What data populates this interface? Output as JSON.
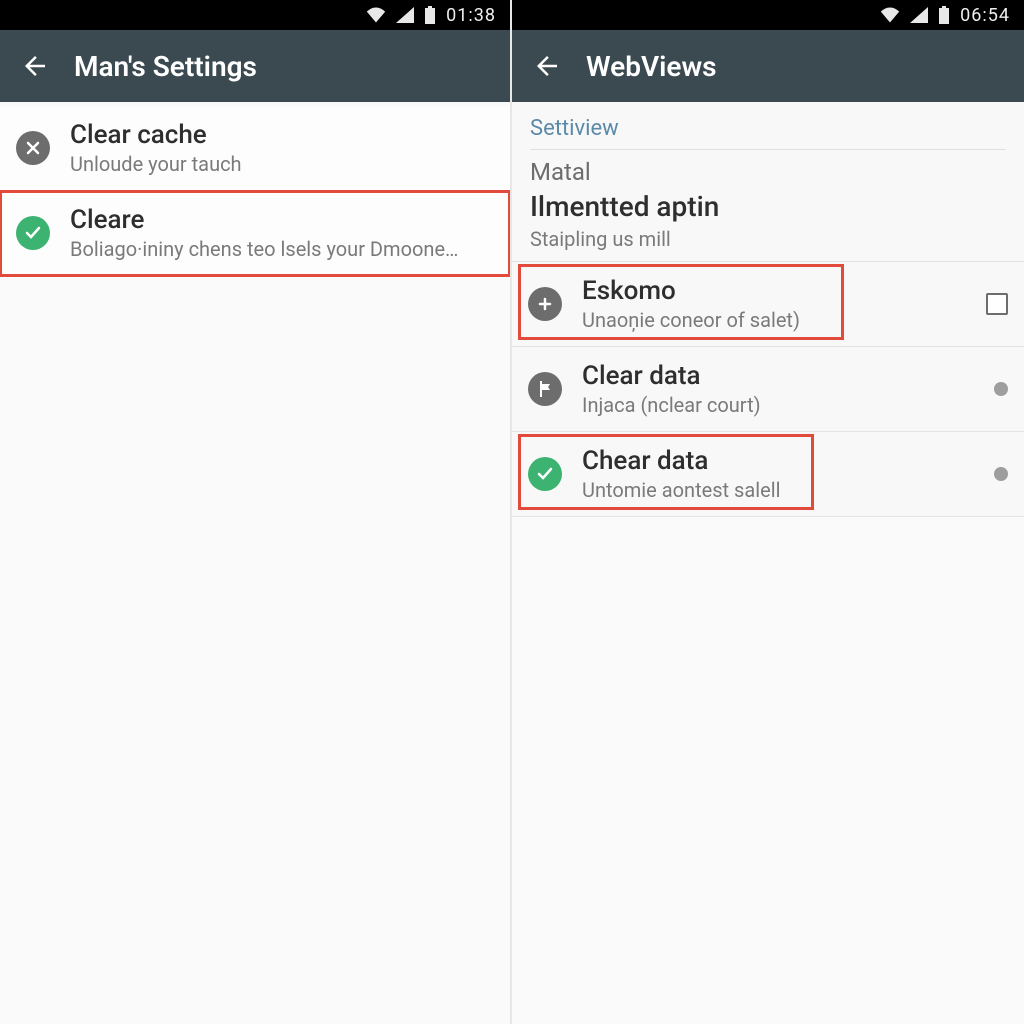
{
  "left": {
    "status": {
      "time": "01:38"
    },
    "appbar": {
      "title": "Man's Settings"
    },
    "rows": [
      {
        "icon": "x",
        "title": "Clear cache",
        "sub": "Unloude your tauch"
      },
      {
        "icon": "check",
        "title": "Cleare",
        "sub": "Boliago·ininy chens teo lsels your Dmoone…"
      }
    ],
    "highlight": [
      false,
      true
    ]
  },
  "right": {
    "status": {
      "time": "06:54"
    },
    "appbar": {
      "title": "WebViews"
    },
    "section": {
      "link": "Settiview",
      "lead": "Matal",
      "big": "Ilmentted aptin",
      "small": "Staipling us mill"
    },
    "rows": [
      {
        "icon": "plus",
        "title": "Eskomo",
        "sub": "Unaoņie coneor of salet)",
        "control": "checkbox"
      },
      {
        "icon": "flag",
        "title": "Clear data",
        "sub": "Injaca (nclear court)",
        "control": "radio"
      },
      {
        "icon": "check",
        "title": "Chear data",
        "sub": "Untomie aontest salell",
        "control": "radio"
      }
    ],
    "highlight": [
      true,
      false,
      true
    ]
  }
}
